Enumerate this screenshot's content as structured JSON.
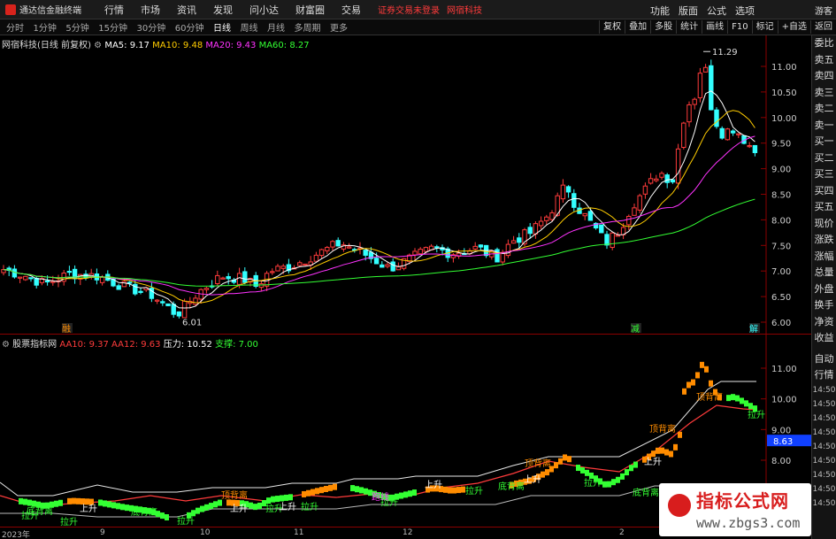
{
  "app": {
    "title": "通达信金融终端"
  },
  "menu": [
    "行情",
    "市场",
    "资讯",
    "发现",
    "问小达",
    "财富圈",
    "交易"
  ],
  "notice": {
    "login": "证券交易未登录",
    "stock": "网宿科技"
  },
  "top_right_menu": [
    "功能",
    "版面",
    "公式",
    "选项"
  ],
  "guest_label": "游客",
  "periods": [
    "分时",
    "1分钟",
    "5分钟",
    "15分钟",
    "30分钟",
    "60分钟",
    "日线",
    "周线",
    "月线",
    "多周期",
    "更多"
  ],
  "active_period": "日线",
  "toolbar_right": [
    "复权",
    "叠加",
    "多股",
    "统计",
    "画线",
    "F10",
    "标记",
    "+自选",
    "返回"
  ],
  "side_panel": [
    "委比",
    "卖五",
    "卖四",
    "卖三",
    "卖二",
    "卖一",
    "买一",
    "买二",
    "买三",
    "买四",
    "买五",
    "现价",
    "涨跌",
    "涨幅",
    "总量",
    "外盘",
    "换手",
    "净资",
    "收益"
  ],
  "side_panel_lower": [
    "自动",
    "行情",
    "14:50",
    "14:50",
    "14:50",
    "14:50",
    "14:50",
    "14:50",
    "14:50",
    "14:50",
    "14:50"
  ],
  "main_chart": {
    "stock_name": "网宿科技(日线 前复权)",
    "ma": [
      {
        "label": "MA5: 9.17",
        "color": "#ffffff"
      },
      {
        "label": "MA10: 9.48",
        "color": "#ffcc00"
      },
      {
        "label": "MA20: 9.43",
        "color": "#ff33ff"
      },
      {
        "label": "MA60: 8.27",
        "color": "#33ff33"
      }
    ],
    "y_ticks": [
      "11.00",
      "10.50",
      "10.00",
      "9.50",
      "9.00",
      "8.50",
      "8.00",
      "7.50",
      "7.00",
      "6.50",
      "6.00"
    ],
    "high_label": "11.29",
    "low_label": "6.01",
    "markers": [
      "融",
      "减",
      "解"
    ]
  },
  "indicator_chart": {
    "name": "股票指标网",
    "params": [
      {
        "label": "AA10: 9.37",
        "color": "#ff3b3b"
      },
      {
        "label": "AA12: 9.63",
        "color": "#ff3b3b"
      },
      {
        "label": "压力: 10.52",
        "color": "#ffffff"
      },
      {
        "label": "支撑: 7.00",
        "color": "#33ff33"
      }
    ],
    "y_ticks": [
      "11.00",
      "10.00",
      "9.00",
      "8.00"
    ],
    "current_value": "8.63",
    "annotations": [
      {
        "text": "顶背离",
        "color": "#ff8c00"
      },
      {
        "text": "顶背离",
        "color": "#ff8c00"
      },
      {
        "text": "顶背离",
        "color": "#ff8c00"
      },
      {
        "text": "顶背离",
        "color": "#ff8c00"
      },
      {
        "text": "底背离",
        "color": "#33ff33"
      },
      {
        "text": "底背离",
        "color": "#33ff33"
      },
      {
        "text": "底背离",
        "color": "#33ff33"
      },
      {
        "text": "底背离",
        "color": "#33ff33"
      },
      {
        "text": "拉升",
        "color": "#33ff33"
      },
      {
        "text": "拉升",
        "color": "#33ff33"
      },
      {
        "text": "拉升",
        "color": "#33ff33"
      },
      {
        "text": "拉升",
        "color": "#33ff33"
      },
      {
        "text": "拉升",
        "color": "#33ff33"
      },
      {
        "text": "拉升",
        "color": "#33ff33"
      },
      {
        "text": "拉升",
        "color": "#33ff33"
      },
      {
        "text": "拉升",
        "color": "#33ff33"
      },
      {
        "text": "拉升",
        "color": "#33ff33"
      },
      {
        "text": "上升",
        "color": "#ffffff"
      },
      {
        "text": "上升",
        "color": "#ffffff"
      },
      {
        "text": "上升",
        "color": "#ffffff"
      },
      {
        "text": "上升",
        "color": "#ffffff"
      },
      {
        "text": "上升",
        "color": "#ffffff"
      },
      {
        "text": "上升",
        "color": "#ffffff"
      },
      {
        "text": "跑线",
        "color": "#ff33ff"
      }
    ]
  },
  "date_axis": [
    "2023年",
    "9",
    "10",
    "11",
    "12",
    "2"
  ],
  "watermark": {
    "title": "指标公式网",
    "url": "www.zbgs3.com"
  },
  "colors": {
    "up": "#ff3b3b",
    "down": "#33ffff",
    "ma5": "#ffffff",
    "ma10": "#ffcc00",
    "ma20": "#ff33ff",
    "ma60": "#33ff33",
    "panel_border": "#8b0000"
  }
}
